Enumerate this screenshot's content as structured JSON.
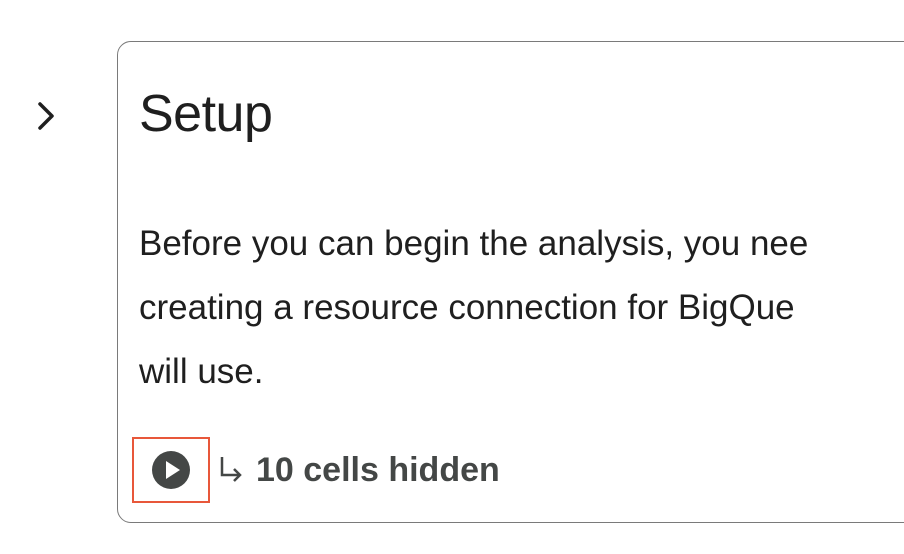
{
  "section": {
    "toggle_icon": "chevron-right-icon",
    "title": "Setup",
    "body_lines": [
      "Before you can begin the analysis, you nee",
      "creating a resource connection for BigQue",
      "will use."
    ],
    "hidden_cells": {
      "label": "10 cells hidden",
      "icon": "subdirectory-arrow-icon"
    },
    "run_button_icon": "play-circle-icon"
  },
  "colors": {
    "text": "#1f1f1f",
    "border": "#7a7a7a",
    "highlight": "#e8573a",
    "icon": "#444746"
  }
}
